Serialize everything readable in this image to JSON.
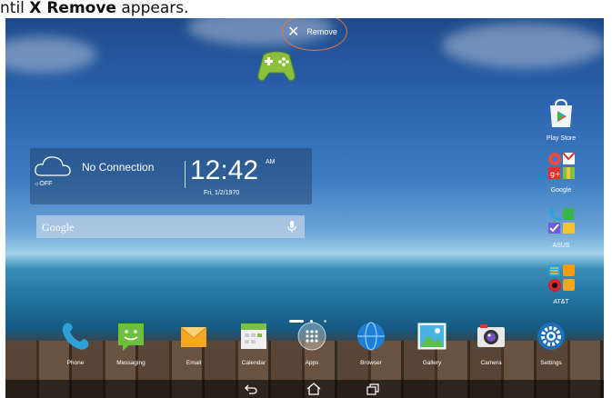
{
  "caption": {
    "prefix": "ntil ",
    "bold": "X Remove",
    "suffix": " appears."
  },
  "remove_bar": {
    "icon": "close-icon",
    "label": "Remove"
  },
  "dragged_icon": {
    "icon": "gamepad-icon",
    "color": "#8bbf3c"
  },
  "weather_widget": {
    "status": "No Connection",
    "toggle": "OFF",
    "time": "12:42",
    "ampm": "AM",
    "date": "Fri, 1/2/1970"
  },
  "search_bar": {
    "logo": "Google",
    "mic_icon": "mic-icon"
  },
  "side_apps": [
    {
      "label": "Play Store",
      "icon": "play-store-icon"
    },
    {
      "label": "Google",
      "icon": "google-folder-icon"
    },
    {
      "label": "ASUS",
      "icon": "asus-folder-icon"
    },
    {
      "label": "AT&T",
      "icon": "att-folder-icon"
    }
  ],
  "dock_apps": [
    {
      "label": "Phone",
      "icon": "phone-icon"
    },
    {
      "label": "Messaging",
      "icon": "messaging-icon"
    },
    {
      "label": "Email",
      "icon": "email-icon"
    },
    {
      "label": "Calendar",
      "icon": "calendar-icon"
    },
    {
      "label": "Apps",
      "icon": "apps-icon"
    },
    {
      "label": "Browser",
      "icon": "browser-icon"
    },
    {
      "label": "Gallery",
      "icon": "gallery-icon"
    },
    {
      "label": "Camera",
      "icon": "camera-icon"
    },
    {
      "label": "Settings",
      "icon": "settings-icon"
    }
  ],
  "nav_buttons": [
    "back-icon",
    "home-icon",
    "recents-icon"
  ],
  "colors": {
    "highlight_ring": "#e8743a"
  }
}
